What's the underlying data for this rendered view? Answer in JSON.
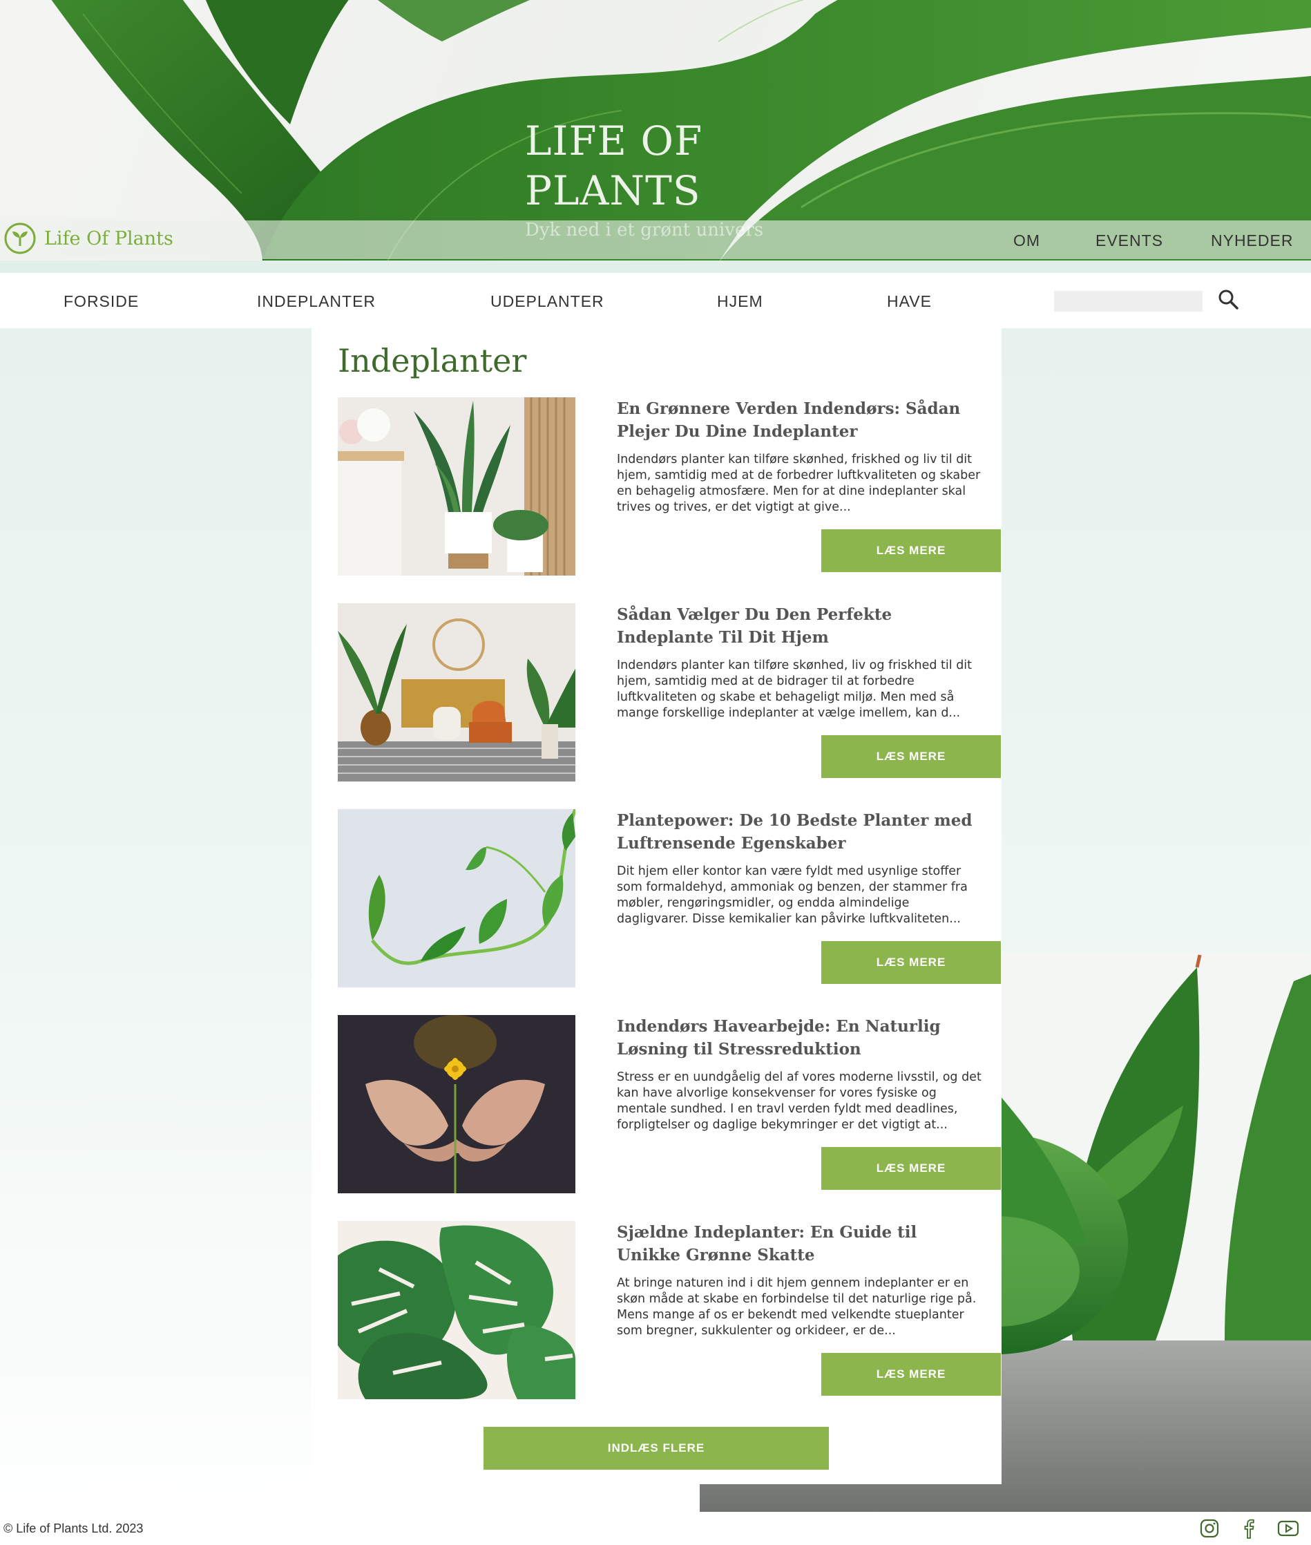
{
  "hero": {
    "title": "LIFE OF\nPLANTS",
    "subtitle": "Dyk ned i et grønt univers"
  },
  "brand": {
    "logo_text": "Life Of Plants",
    "logo_icon": "sprout-icon",
    "accent": "#8db54d",
    "title_green": "#3e6a2c"
  },
  "top_nav": [
    "OM",
    "EVENTS",
    "NYHEDER"
  ],
  "main_nav": [
    "FORSIDE",
    "INDEPLANTER",
    "UDEPLANTER",
    "HJEM",
    "HAVE"
  ],
  "search": {
    "placeholder": "",
    "icon": "search-icon"
  },
  "section": {
    "title": "Indeplanter"
  },
  "articles": [
    {
      "title": "En Grønnere Verden Indendørs: Sådan Plejer Du Dine Indeplanter",
      "body": "Indendørs planter kan tilføre skønhed, friskhed og liv til dit hjem, samtidig med at de forbedrer luftkvaliteten og skaber en behagelig atmosfære. Men for at dine indeplanter skal trives og trives, er det vigtigt at give...",
      "button": "LÆS MERE"
    },
    {
      "title": "Sådan Vælger Du Den Perfekte Indeplante Til Dit Hjem",
      "body": "Indendørs planter kan tilføre skønhed, liv og friskhed til dit hjem, samtidig med at de bidrager til at forbedre luftkvaliteten og skabe et behageligt miljø. Men med så mange forskellige indeplanter at vælge imellem, kan d...",
      "button": "LÆS MERE"
    },
    {
      "title": "Plantepower: De 10 Bedste Planter med Luftrensende Egenskaber",
      "body": "Dit hjem eller kontor kan være fyldt med usynlige stoffer som formaldehyd, ammoniak og benzen, der stammer fra møbler, rengøringsmidler, og endda almindelige dagligvarer. Disse kemikalier kan påvirke luftkvaliteten...",
      "button": "LÆS MERE"
    },
    {
      "title": "Indendørs Havearbejde: En Naturlig Løsning til Stressreduktion",
      "body": "Stress er en uundgåelig del af vores moderne livsstil, og det kan have alvorlige konsekvenser for vores fysiske og mentale sundhed. I en travl verden fyldt med deadlines, forpligtelser og daglige bekymringer er det vigtigt at...",
      "button": "LÆS MERE"
    },
    {
      "title": "Sjældne Indeplanter: En Guide til Unikke Grønne Skatte",
      "body": "At bringe naturen ind i dit hjem gennem indeplanter er en skøn måde at skabe en forbindelse til det naturlige rige på. Mens mange af os er bekendt med velkendte stueplanter som bregner, sukkulenter og orkideer, er de...",
      "button": "LÆS MERE"
    }
  ],
  "load_more": "INDLÆS FLERE",
  "footer": {
    "copyright": "© Life of Plants Ltd. 2023",
    "social": [
      "instagram-icon",
      "facebook-icon",
      "youtube-icon"
    ]
  }
}
